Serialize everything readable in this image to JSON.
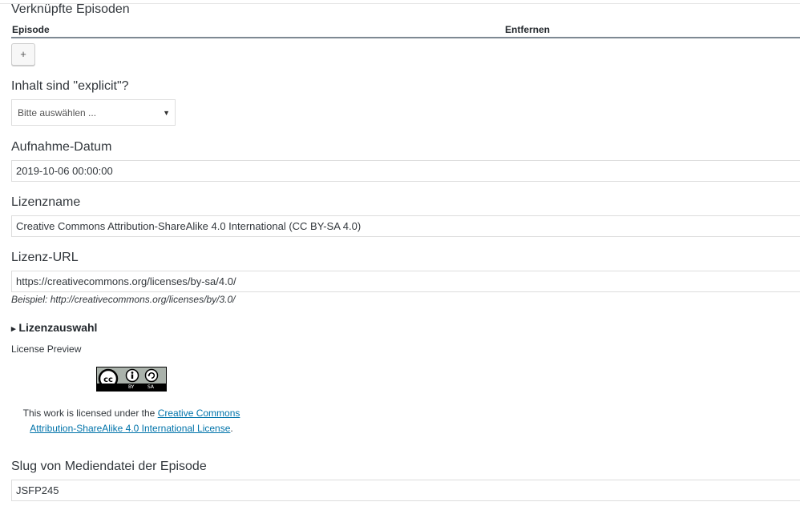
{
  "episodes_section": {
    "title": "Verknüpfte Episoden",
    "col_episode": "Episode",
    "col_remove": "Entfernen",
    "add_button": "+"
  },
  "explicit": {
    "label": "Inhalt sind \"explicit\"?",
    "selected": "Bitte auswählen ..."
  },
  "recording_date": {
    "label": "Aufnahme-Datum",
    "value": "2019-10-06 00:00:00"
  },
  "license_name": {
    "label": "Lizenzname",
    "value": "Creative Commons Attribution-ShareAlike 4.0 International (CC BY-SA 4.0)"
  },
  "license_url": {
    "label": "Lizenz-URL",
    "value": "https://creativecommons.org/licenses/by-sa/4.0/",
    "hint": "Beispiel: http://creativecommons.org/licenses/by/3.0/"
  },
  "license_selector": {
    "toggle": "Lizenzauswahl",
    "preview_label": "License Preview",
    "badge_by": "BY",
    "badge_sa": "SA",
    "text_prefix": "This work is licensed under the ",
    "link_text": "Creative Commons Attribution-ShareAlike 4.0 International License",
    "text_suffix": "."
  },
  "slug": {
    "label": "Slug von Mediendatei der Episode",
    "value": "JSFP245"
  },
  "colors": {
    "link": "#0073aa",
    "border": "#dddddd",
    "text": "#32373c"
  }
}
